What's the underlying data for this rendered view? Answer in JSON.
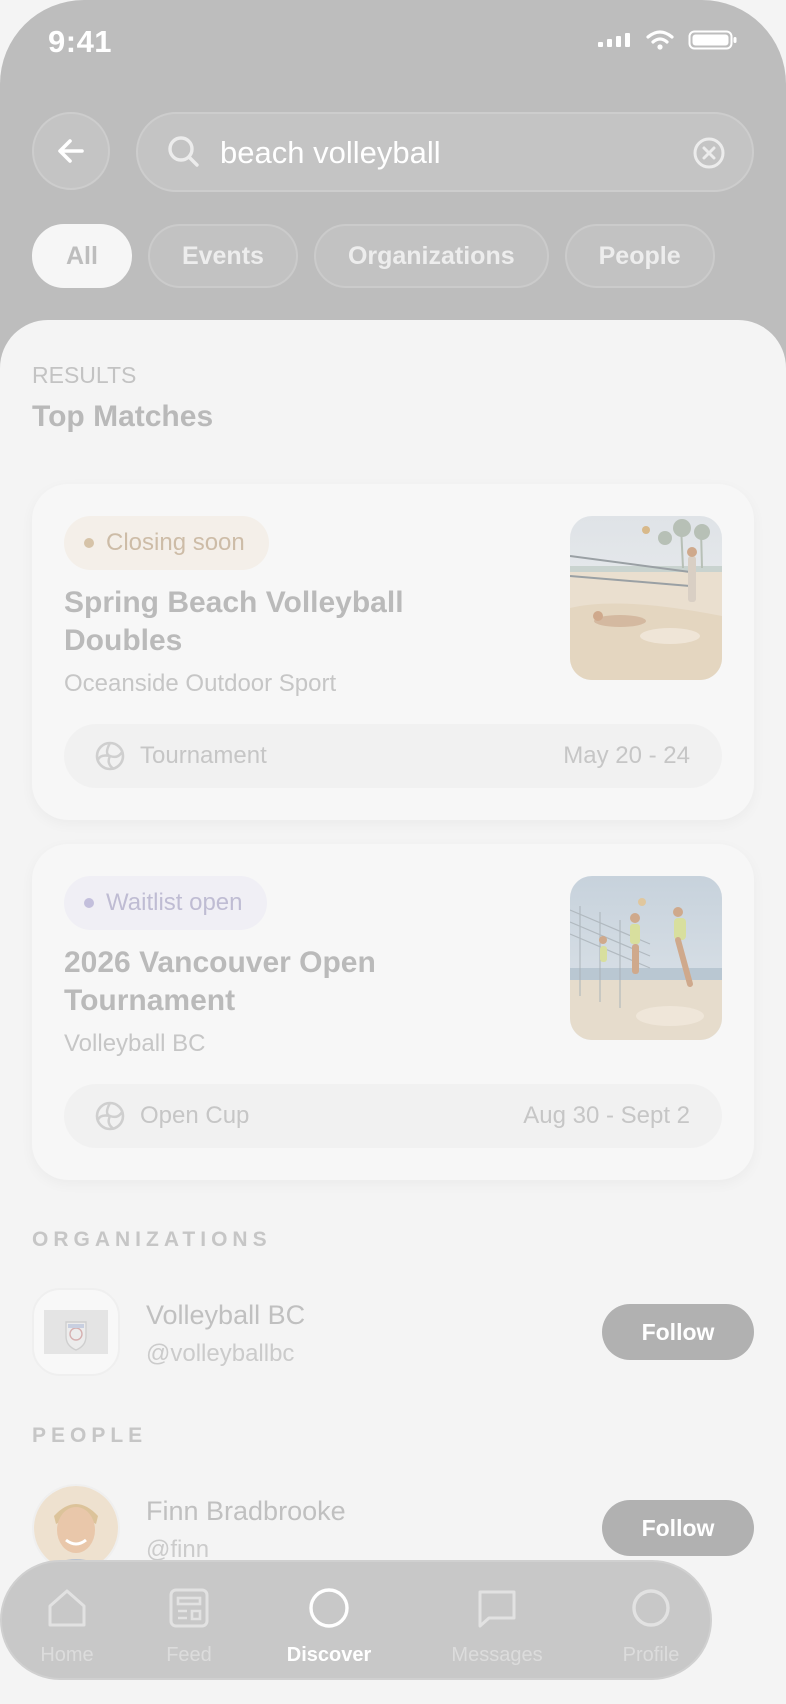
{
  "status": {
    "time": "9:41"
  },
  "search": {
    "query": "beach volleyball"
  },
  "filters": [
    "All",
    "Events",
    "Organizations",
    "People"
  ],
  "results": {
    "label": "RESULTS",
    "title": "Top Matches"
  },
  "cards": [
    {
      "badge": "Closing soon",
      "title": "Spring Beach Volleyball Doubles",
      "organizer": "Oceanside Outdoor Sport",
      "type": "Tournament",
      "dates": "May 20 - 24"
    },
    {
      "badge": "Waitlist open",
      "title": "2026 Vancouver Open Tournament",
      "organizer": "Volleyball BC",
      "type": "Open Cup",
      "dates": "Aug 30 - Sept 2"
    }
  ],
  "organizations": {
    "label": "ORGANIZATIONS",
    "items": [
      {
        "name": "Volleyball BC",
        "handle": "@volleyballbc",
        "action": "Follow"
      }
    ]
  },
  "people": {
    "label": "PEOPLE",
    "items": [
      {
        "name": "Finn Bradbrooke",
        "handle": "@finn",
        "action": "Follow"
      }
    ]
  },
  "tabbar": {
    "items": [
      "Home",
      "Feed",
      "Discover",
      "Messages",
      "Profile"
    ],
    "active": "Discover"
  }
}
